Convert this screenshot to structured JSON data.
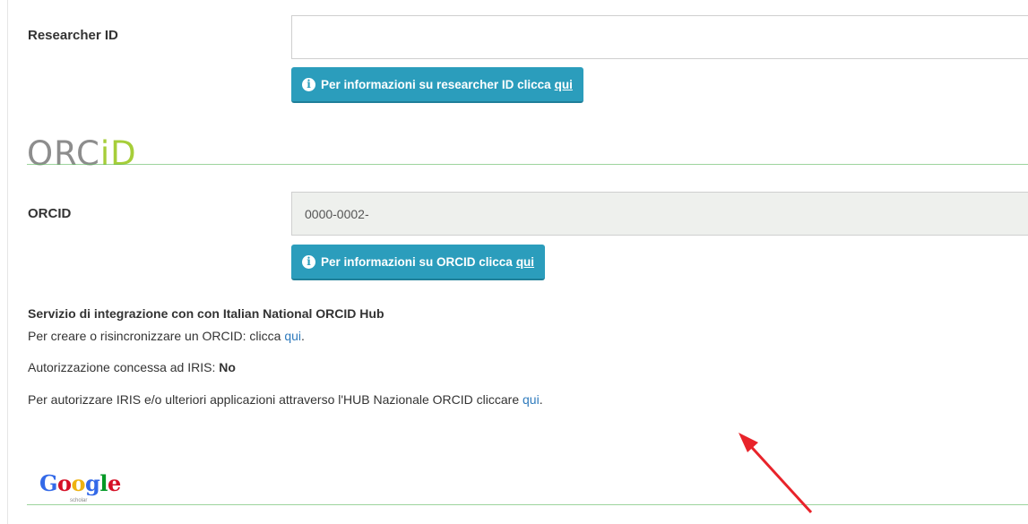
{
  "researcher_id": {
    "label": "Researcher ID",
    "value": "",
    "info_text": "Per informazioni su researcher ID clicca",
    "info_link": "qui"
  },
  "orcid_section": {
    "logo_grey": "ORC",
    "logo_green": "iD",
    "label": "ORCID",
    "value": "0000-0002-",
    "info_text": "Per informazioni su ORCID clicca",
    "info_link": "qui"
  },
  "hub": {
    "title": "Servizio di integrazione con con Italian National ORCID Hub",
    "create_text": "Per creare o risincronizzare un ORCID: clicca",
    "create_link": "qui",
    "auth_text": "Autorizzazione concessa ad IRIS:",
    "auth_value": "No",
    "authorize_text": "Per autorizzare IRIS e/o ulteriori applicazioni attraverso l'HUB Nazionale ORCID cliccare",
    "authorize_link": "qui"
  },
  "google_scholar": {
    "letters": [
      "G",
      "o",
      "o",
      "g",
      "l",
      "e"
    ],
    "colors": [
      "#3369e8",
      "#d50f25",
      "#eeb211",
      "#3369e8",
      "#009925",
      "#d50f25"
    ],
    "sub_label": "scholar"
  },
  "accent_colors": {
    "button": "#2b9dbc",
    "link": "#2f7bbd",
    "orcid_green": "#a6ce39",
    "arrow": "#e8232a"
  }
}
